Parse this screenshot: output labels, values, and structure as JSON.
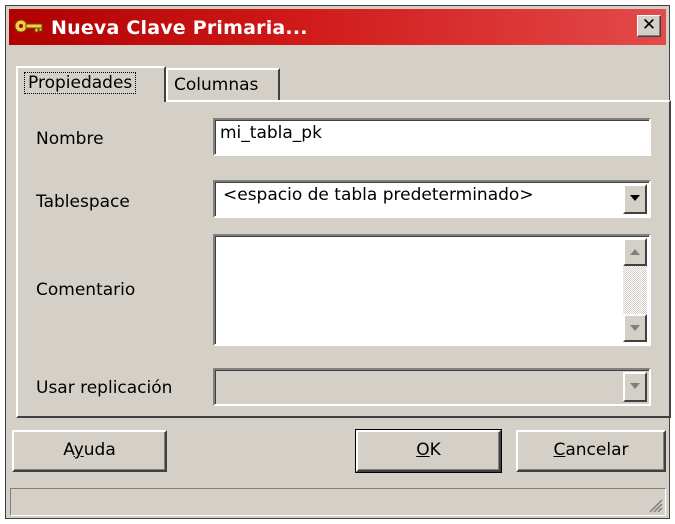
{
  "window": {
    "title": "Nueva Clave Primaria...",
    "close_label": "✕"
  },
  "tabs": [
    {
      "label": "Propiedades",
      "active": true
    },
    {
      "label": "Columnas",
      "active": false
    }
  ],
  "form": {
    "nombre_label": "Nombre",
    "nombre_value": "mi_tabla_pk",
    "tablespace_label": "Tablespace",
    "tablespace_value": "<espacio de tabla predeterminado>",
    "comentario_label": "Comentario",
    "comentario_value": "",
    "replicacion_label": "Usar replicación",
    "replicacion_value": ""
  },
  "buttons": {
    "help_pre": "A",
    "help_mnemonic": "y",
    "help_post": "uda",
    "ok_mnemonic": "O",
    "ok_post": "K",
    "cancel_mnemonic": "C",
    "cancel_post": "ancelar"
  },
  "colors": {
    "titlebar_start": "#b00000",
    "titlebar_end": "#e34a4a",
    "face": "#d4d0c8"
  }
}
